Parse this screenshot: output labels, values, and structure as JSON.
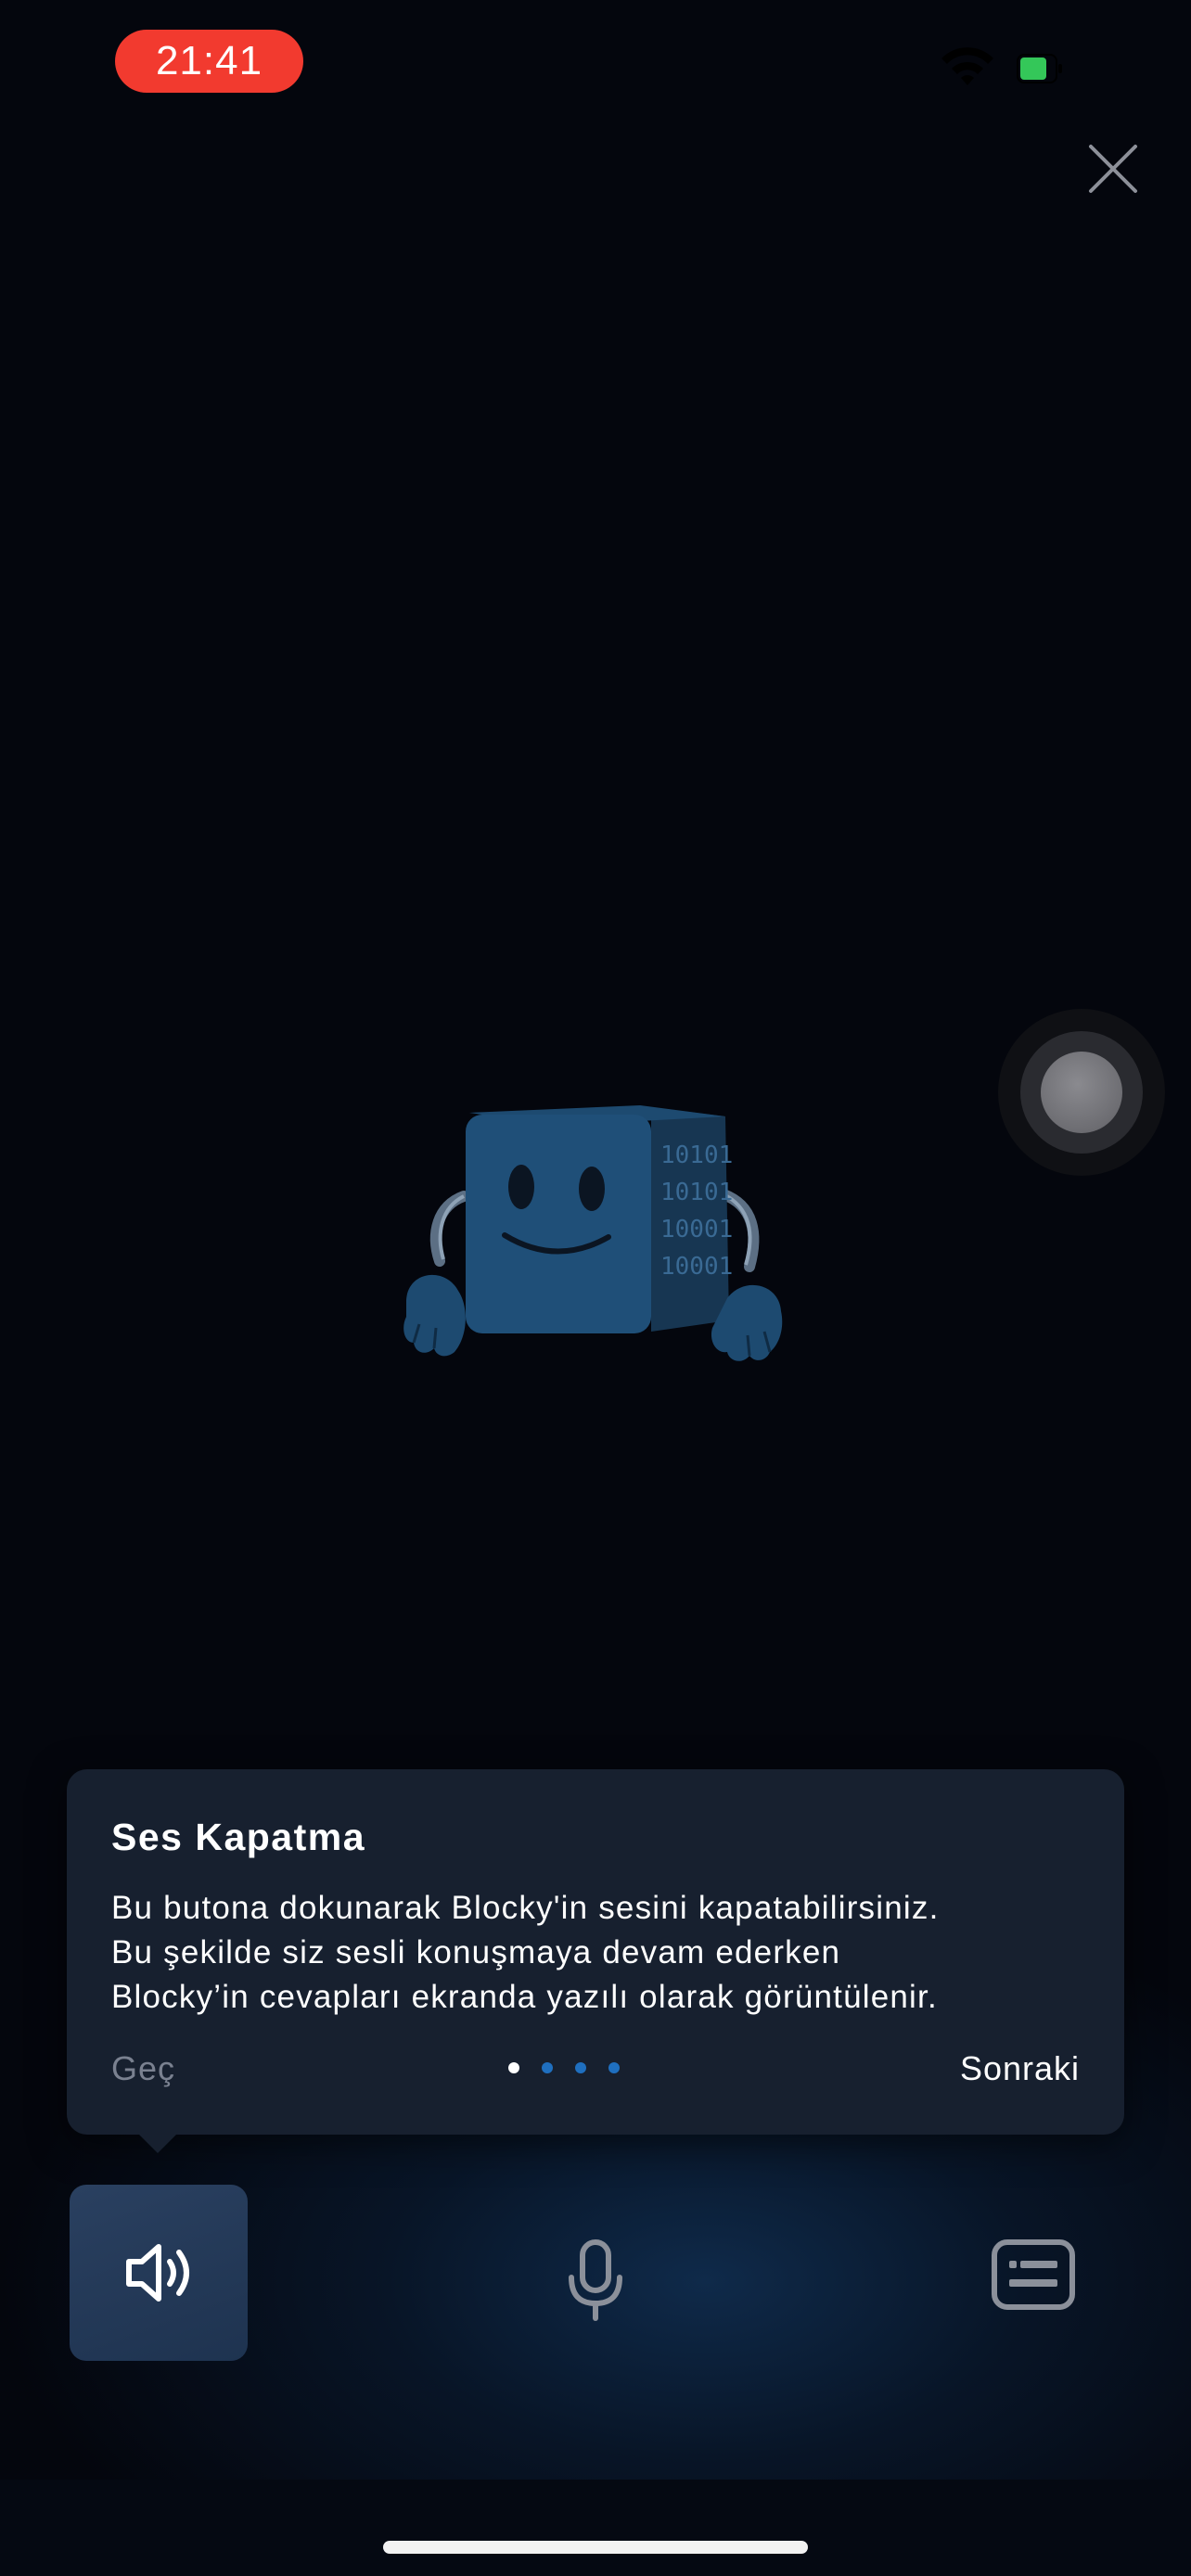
{
  "status_bar": {
    "time": "21:41",
    "time_pill_color": "#f23a2f",
    "icons": [
      "wifi-icon",
      "battery-icon"
    ]
  },
  "top_bar": {
    "close_icon": "close-icon"
  },
  "assistive_touch": {
    "icon": "assistive-touch-icon"
  },
  "mascot": {
    "icon": "blocky-mascot",
    "cube_digits": [
      "10101",
      "10101",
      "10001",
      "10001"
    ]
  },
  "tooltip": {
    "title": "Ses Kapatma",
    "body_lines": [
      "Bu butona dokunarak Blocky'in sesini kapatabilirsiniz.",
      "Bu şekilde siz sesli konuşmaya devam ederken",
      "Blocky’in cevapları ekranda yazılı olarak görüntülenir."
    ],
    "skip_label": "Geç",
    "next_label": "Sonraki",
    "pager": {
      "total": 4,
      "current": 1,
      "active_color": "#ffffff",
      "inactive_color": "#1f6fbf"
    }
  },
  "controls": {
    "speaker": "speaker-icon",
    "mic": "microphone-icon",
    "keyboard": "keyboard-icon",
    "accent": "#2a4060"
  }
}
